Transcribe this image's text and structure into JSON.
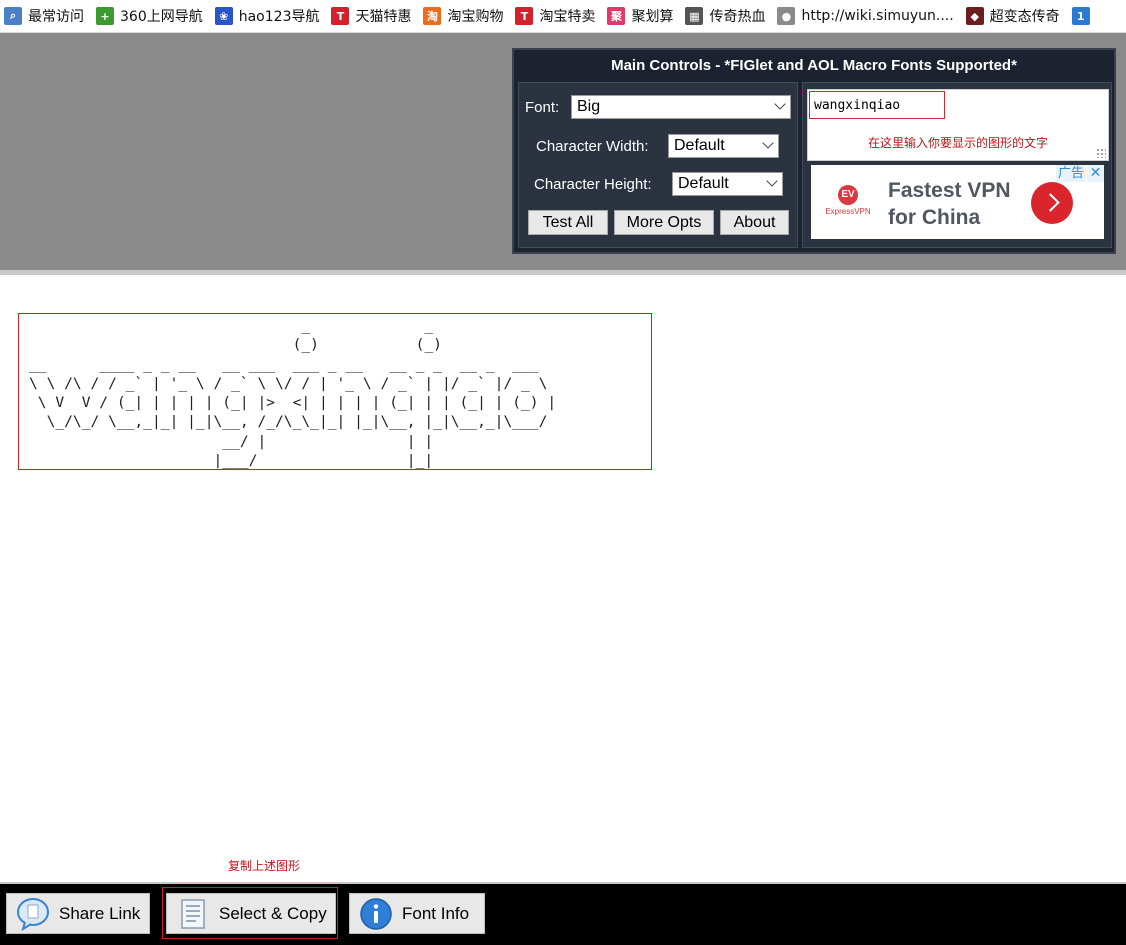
{
  "bookmarks": [
    {
      "label": "最常访问",
      "icon": "search-page-icon",
      "color": "#4d7fc4",
      "glyph": "⌕"
    },
    {
      "label": "360上网导航",
      "icon": "360-plus-icon",
      "color": "#3b9b2f",
      "glyph": "+"
    },
    {
      "label": "hao123导航",
      "icon": "paw-icon",
      "color": "#2a55c7",
      "glyph": "❀"
    },
    {
      "label": "天猫特惠",
      "icon": "tmall-icon",
      "color": "#d4202a",
      "glyph": "T"
    },
    {
      "label": "淘宝购物",
      "icon": "taobao-icon",
      "color": "#f26a1b",
      "glyph": "淘"
    },
    {
      "label": "淘宝特卖",
      "icon": "tmall-icon",
      "color": "#d4202a",
      "glyph": "T"
    },
    {
      "label": "聚划算",
      "icon": "juhuasuan-icon",
      "color": "#e3376b",
      "glyph": "聚"
    },
    {
      "label": "传奇热血",
      "icon": "game-icon",
      "color": "#555555",
      "glyph": "▦"
    },
    {
      "label": "http://wiki.simuyun....",
      "icon": "globe-icon",
      "color": "#8a8a8a",
      "glyph": "●"
    },
    {
      "label": "超变态传奇",
      "icon": "game-shield-icon",
      "color": "#6b1e1e",
      "glyph": "◆"
    },
    {
      "label": "",
      "icon": "calendar-icon",
      "color": "#2a7ad1",
      "glyph": "1"
    }
  ],
  "controls": {
    "title": "Main Controls - *FIGlet and AOL Macro Fonts Supported*",
    "font_label": "Font:",
    "font_value": "Big",
    "width_label": "Character Width:",
    "width_value": "Default",
    "height_label": "Character Height:",
    "height_value": "Default",
    "test_all": "Test All",
    "more_opts": "More Opts",
    "about": "About"
  },
  "text_input": {
    "value": "wangxinqiao",
    "hint": "在这里输入你要显示的图形的文字"
  },
  "ad": {
    "logo_mark": "EV",
    "logo_text": "ExpressVPN",
    "headline": "Fastest VPN\nfor China",
    "label": "广告",
    "close": "✕",
    "brand_color": "#da3940"
  },
  "ascii_art": "                               _             _\n                              (_)           (_)\n__      ____ _ _ __   __ ___  ___ _ __   __ _ _  __ _  ___\n\\ \\ /\\ / / _` | '_ \\ / _` \\ \\/ / | '_ \\ / _` | |/ _` |/ _ \\\n \\ V  V / (_| | | | | (_| |>  <| | | | | (_| | | (_| | (_) |\n  \\_/\\_/ \\__,_|_| |_|\\__, /_/\\_\\_|_| |_|\\__, |_|\\__,_|\\___/\n                      __/ |                | |\n                     |___/                 |_|",
  "copy_hint": "复制上述图形",
  "bottom": {
    "share_link": "Share Link",
    "select_copy": "Select & Copy",
    "font_info": "Font Info"
  }
}
